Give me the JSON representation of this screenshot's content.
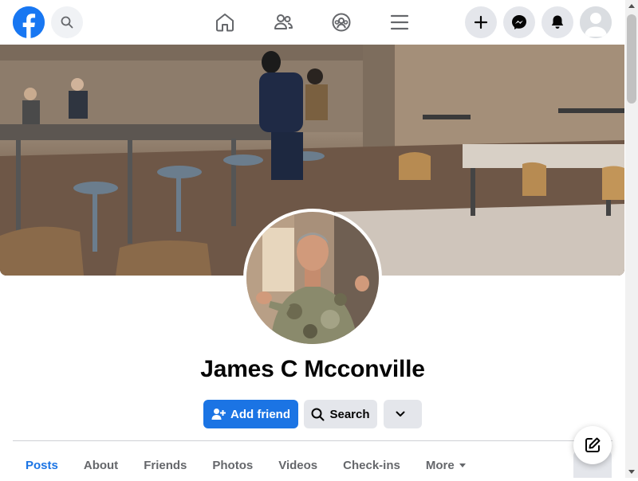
{
  "nav": {
    "logo_icon": "facebook-logo-icon",
    "search_icon": "search-icon",
    "center_icons": [
      "home-icon",
      "friends-icon",
      "groups-icon",
      "menu-icon"
    ],
    "right_icons": [
      "plus-icon",
      "messenger-icon",
      "bell-icon",
      "avatar-icon"
    ]
  },
  "profile": {
    "name": "James C Mcconville"
  },
  "actions": {
    "add_friend": "Add friend",
    "search": "Search"
  },
  "tabs": [
    {
      "label": "Posts",
      "active": true
    },
    {
      "label": "About"
    },
    {
      "label": "Friends"
    },
    {
      "label": "Photos"
    },
    {
      "label": "Videos"
    },
    {
      "label": "Check-ins"
    },
    {
      "label": "More"
    }
  ],
  "colors": {
    "brand": "#1877f2",
    "primary_button": "#1b74e4",
    "secondary_button": "#e4e6eb"
  }
}
